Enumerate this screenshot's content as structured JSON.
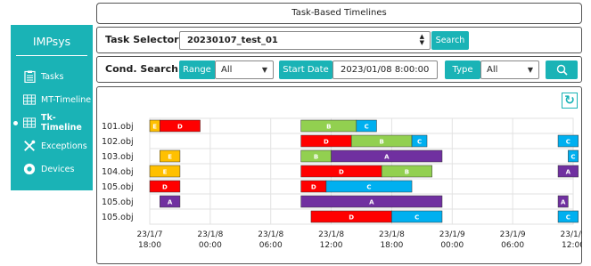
{
  "header": {
    "title": "Task-Based Timelines"
  },
  "sidebar": {
    "brand": "IMPsys",
    "items": [
      {
        "label": "Tasks",
        "icon": "clipboard-icon",
        "active": false
      },
      {
        "label": "MT-Timeline",
        "icon": "grid-icon",
        "active": false
      },
      {
        "label": "Tk-Timeline",
        "icon": "grid-icon",
        "active": true
      },
      {
        "label": "Exceptions",
        "icon": "tools-icon",
        "active": false
      },
      {
        "label": "Devices",
        "icon": "device-icon",
        "active": false
      }
    ]
  },
  "task_selector": {
    "label": "Task Selector",
    "value": "20230107_test_01",
    "search_label": "Search"
  },
  "cond_search": {
    "label": "Cond. Search",
    "range_label": "Range",
    "range_value": "All",
    "start_label": "Start Date",
    "start_value": "2023/01/08 8:00:00",
    "type_label": "Type",
    "type_value": "All"
  },
  "chart_data": {
    "type": "timeline",
    "xlim": [
      "2023-01-07 18:00",
      "2023-01-09 12:00"
    ],
    "x_ticks": [
      {
        "line1": "23/1/7",
        "line2": "18:00"
      },
      {
        "line1": "23/1/8",
        "line2": "00:00"
      },
      {
        "line1": "23/1/8",
        "line2": "06:00"
      },
      {
        "line1": "23/1/8",
        "line2": "12:00"
      },
      {
        "line1": "23/1/8",
        "line2": "18:00"
      },
      {
        "line1": "23/1/9",
        "line2": "00:00"
      },
      {
        "line1": "23/1/9",
        "line2": "06:00"
      },
      {
        "line1": "23/1/9",
        "line2": "12:00"
      }
    ],
    "colors": {
      "A": "#7030a0",
      "B": "#92d050",
      "C": "#00b0f0",
      "D": "#ff0000",
      "E": "#ffc000"
    },
    "rows": [
      {
        "label": "101.obj",
        "tasks": [
          {
            "type": "E",
            "start": "2023-01-07 18:00",
            "end": "2023-01-07 19:00"
          },
          {
            "type": "D",
            "start": "2023-01-07 19:00",
            "end": "2023-01-07 23:00"
          },
          {
            "type": "B",
            "start": "2023-01-08 09:00",
            "end": "2023-01-08 14:30"
          },
          {
            "type": "C",
            "start": "2023-01-08 14:30",
            "end": "2023-01-08 16:30"
          }
        ]
      },
      {
        "label": "102.obj",
        "tasks": [
          {
            "type": "D",
            "start": "2023-01-08 09:00",
            "end": "2023-01-08 14:00"
          },
          {
            "type": "B",
            "start": "2023-01-08 14:00",
            "end": "2023-01-08 20:00"
          },
          {
            "type": "C",
            "start": "2023-01-08 20:00",
            "end": "2023-01-08 21:30"
          },
          {
            "type": "C",
            "start": "2023-01-09 10:30",
            "end": "2023-01-09 12:30"
          }
        ]
      },
      {
        "label": "103.obj",
        "tasks": [
          {
            "type": "E",
            "start": "2023-01-07 19:00",
            "end": "2023-01-07 21:00"
          },
          {
            "type": "B",
            "start": "2023-01-08 09:00",
            "end": "2023-01-08 12:00"
          },
          {
            "type": "A",
            "start": "2023-01-08 12:00",
            "end": "2023-01-08 23:00"
          },
          {
            "type": "C",
            "start": "2023-01-09 11:30",
            "end": "2023-01-09 12:30"
          }
        ]
      },
      {
        "label": "104.obj",
        "tasks": [
          {
            "type": "E",
            "start": "2023-01-07 18:00",
            "end": "2023-01-07 21:00"
          },
          {
            "type": "D",
            "start": "2023-01-08 09:00",
            "end": "2023-01-08 17:00"
          },
          {
            "type": "B",
            "start": "2023-01-08 17:00",
            "end": "2023-01-08 22:00"
          },
          {
            "type": "A",
            "start": "2023-01-09 10:30",
            "end": "2023-01-09 12:30"
          }
        ]
      },
      {
        "label": "105.obj",
        "tasks": [
          {
            "type": "D",
            "start": "2023-01-07 18:00",
            "end": "2023-01-07 21:00"
          },
          {
            "type": "D",
            "start": "2023-01-08 09:00",
            "end": "2023-01-08 11:30"
          },
          {
            "type": "C",
            "start": "2023-01-08 11:30",
            "end": "2023-01-08 20:00"
          }
        ]
      },
      {
        "label": "105.obj",
        "tasks": [
          {
            "type": "A",
            "start": "2023-01-07 19:00",
            "end": "2023-01-07 21:00"
          },
          {
            "type": "A",
            "start": "2023-01-08 09:00",
            "end": "2023-01-08 23:00"
          },
          {
            "type": "A",
            "start": "2023-01-09 10:30",
            "end": "2023-01-09 11:30"
          }
        ]
      },
      {
        "label": "105.obj",
        "tasks": [
          {
            "type": "D",
            "start": "2023-01-08 10:00",
            "end": "2023-01-08 18:00"
          },
          {
            "type": "C",
            "start": "2023-01-08 18:00",
            "end": "2023-01-08 23:00"
          },
          {
            "type": "C",
            "start": "2023-01-09 10:30",
            "end": "2023-01-09 12:30"
          }
        ]
      }
    ]
  }
}
